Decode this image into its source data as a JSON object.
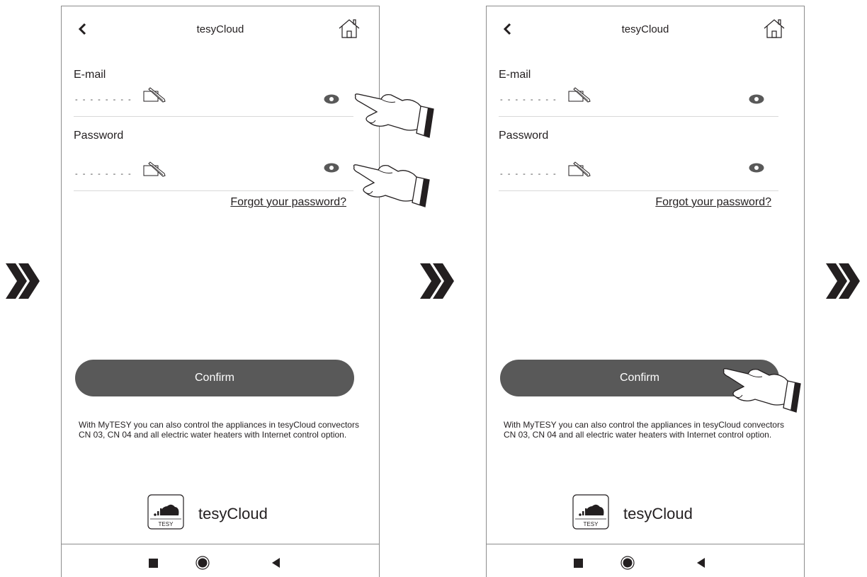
{
  "screens": [
    {
      "header": {
        "title": "tesyCloud",
        "back_icon": "chevron-left-icon",
        "home_icon": "home-icon"
      },
      "email": {
        "label": "E-mail"
      },
      "password": {
        "label": "Password"
      },
      "forgot_link": "Forgot your password?",
      "confirm_label": "Confirm",
      "info_text": "With MyTESY you can also control the appliances in tesyCloud convectors  CN 03, CN 04 and all electric water heaters with Internet control option.",
      "logo": {
        "badge_text": "TESY",
        "name": "tesyCloud"
      }
    },
    {
      "header": {
        "title": "tesyCloud",
        "back_icon": "chevron-left-icon",
        "home_icon": "home-icon"
      },
      "email": {
        "label": "E-mail"
      },
      "password": {
        "label": "Password"
      },
      "forgot_link": "Forgot your password?",
      "confirm_label": "Confirm",
      "info_text": "With MyTESY you can also control the appliances in tesyCloud convectors  CN 03, CN 04 and all electric water heaters with Internet control option.",
      "logo": {
        "badge_text": "TESY",
        "name": "tesyCloud"
      }
    }
  ],
  "field_placeholder": "- - - - - - - -",
  "step_arrow_icon": "double-chevron-right-icon",
  "hand_icon": "pointing-hand-icon",
  "colors": {
    "button": "#595959",
    "text": "#231f20",
    "border": "#8c8c8c"
  }
}
